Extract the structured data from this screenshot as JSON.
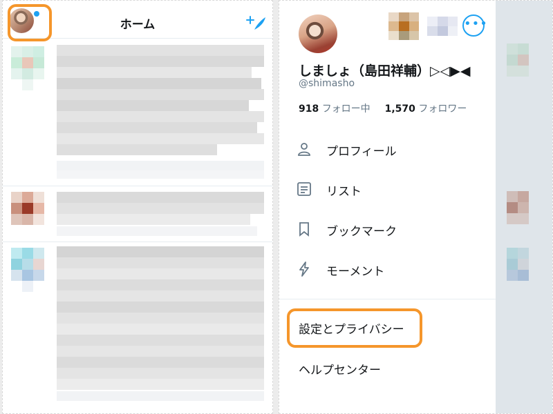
{
  "home": {
    "title": "ホーム"
  },
  "drawer": {
    "display_name": "しましょ（島田祥輔）▷◁▶◀",
    "handle": "@shimasho",
    "following_count": "918",
    "following_label": "フォロー中",
    "followers_count": "1,570",
    "followers_label": "フォロワー",
    "more_label": "•••",
    "menu": [
      {
        "label": "プロフィール",
        "icon": "person-icon"
      },
      {
        "label": "リスト",
        "icon": "list-icon"
      },
      {
        "label": "ブックマーク",
        "icon": "bookmark-icon"
      },
      {
        "label": "モーメント",
        "icon": "lightning-icon"
      }
    ],
    "settings_label": "設定とプライバシー",
    "help_label": "ヘルプセンター"
  },
  "colors": {
    "accent": "#1da1f2",
    "highlight": "#f5962b"
  }
}
